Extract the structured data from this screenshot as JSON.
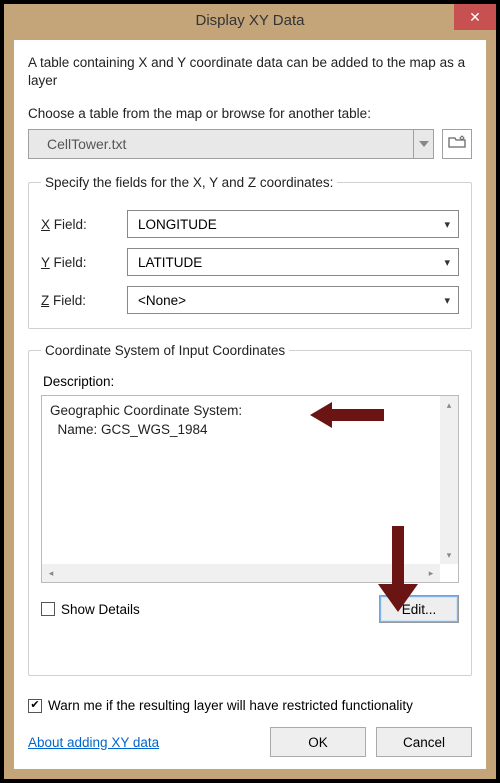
{
  "title": "Display XY Data",
  "intro": "A table containing X and Y coordinate data can be added to the map as a layer",
  "choose_label": "Choose a table from the map or browse for another table:",
  "table_combo": "CellTower.txt",
  "fields_group": {
    "legend": "Specify the fields for the X, Y and Z coordinates:",
    "x_label_pre": "X",
    "x_label_post": " Field:",
    "y_label_pre": "Y",
    "y_label_post": " Field:",
    "z_label_pre": "Z",
    "z_label_post": " Field:",
    "x_value": "LONGITUDE",
    "y_value": "LATITUDE",
    "z_value": "<None>"
  },
  "cs_group": {
    "legend": "Coordinate System of Input Coordinates",
    "desc_label": "Description:",
    "desc_line1": "Geographic Coordinate System:",
    "desc_line2": "  Name: GCS_WGS_1984",
    "show_details_pre": "Show ",
    "show_details_ul": "D",
    "show_details_post": "etails",
    "edit_label": "Edit..."
  },
  "warn_pre": "W",
  "warn_post": "arn me if the resulting layer will have restricted functionality",
  "warn_checked": true,
  "link_label": "About adding XY data",
  "ok_label": "OK",
  "cancel_label": "Cancel"
}
